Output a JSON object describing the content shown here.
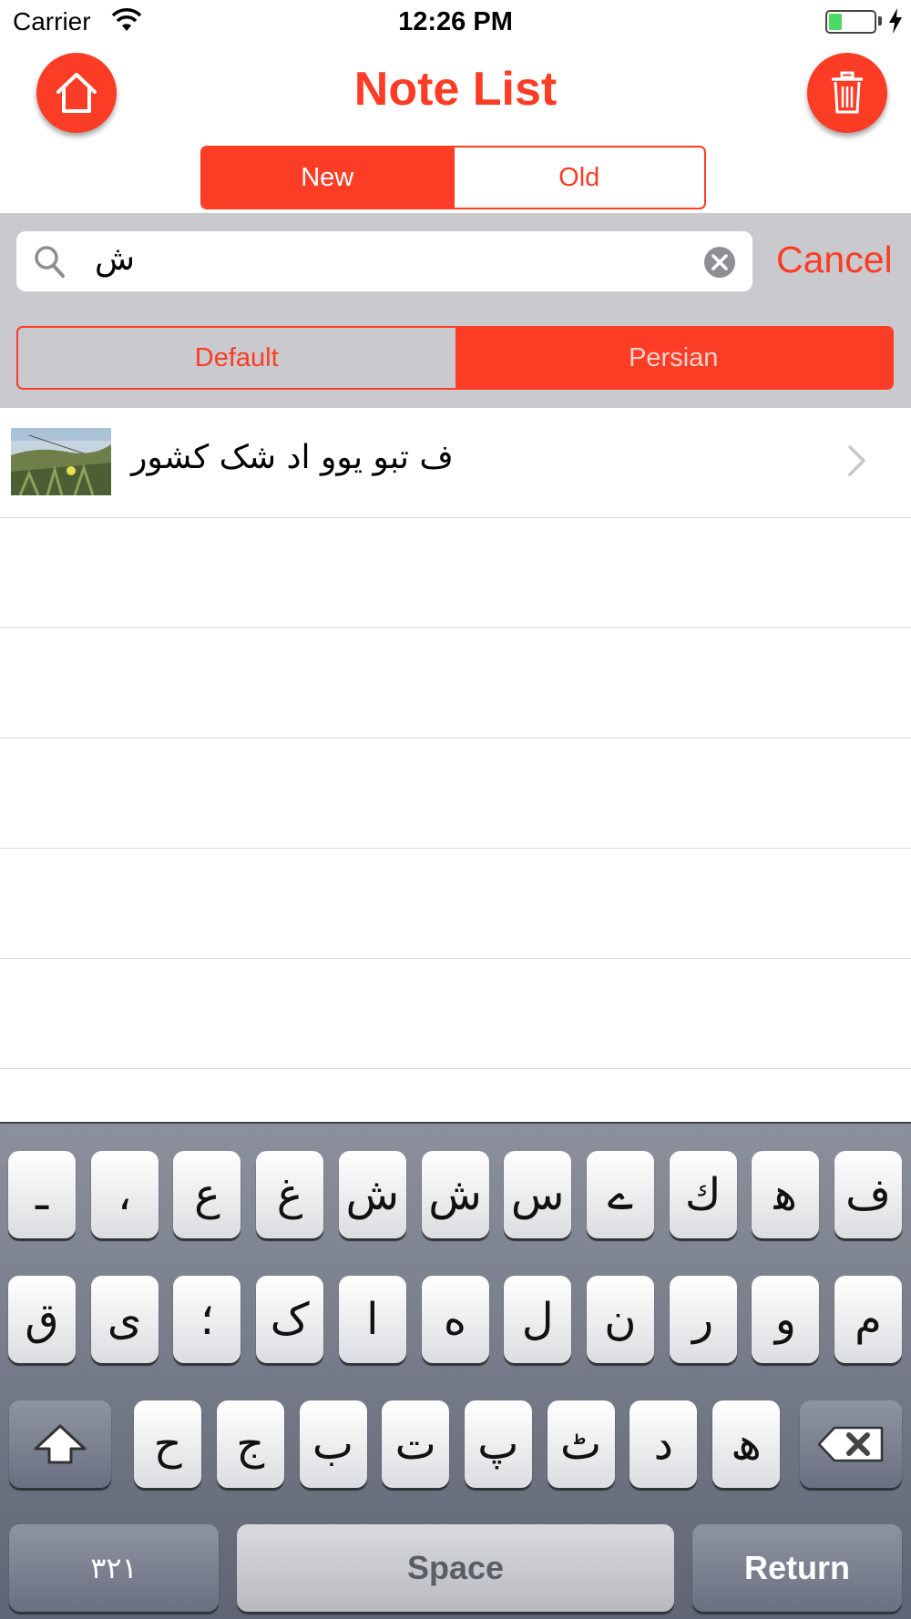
{
  "status_bar": {
    "carrier": "Carrier",
    "time": "12:26 PM",
    "battery_level": 0.3,
    "battery_color": "#4cd964"
  },
  "nav": {
    "title": "Note List",
    "home_icon": "home-icon",
    "trash_icon": "trash-icon",
    "accent_color": "#fc3d26",
    "sort_segments": [
      {
        "label": "New",
        "selected": true
      },
      {
        "label": "Old",
        "selected": false
      }
    ]
  },
  "search": {
    "value": "ش",
    "cancel_label": "Cancel",
    "scope_segments": [
      {
        "label": "Default",
        "selected": false
      },
      {
        "label": "Persian",
        "selected": true
      }
    ]
  },
  "notes": [
    {
      "title": "ف  تبو یوو اد شک کشور",
      "thumbnail": "landscape-photo"
    }
  ],
  "keyboard": {
    "row1": [
      "ف",
      "ﻫ",
      "ك",
      "ے",
      "س",
      "ش",
      "ش",
      "غ",
      "ع",
      "،",
      "ـ"
    ],
    "row2": [
      "م",
      "و",
      "ر",
      "ن",
      "ل",
      "ه",
      "ا",
      "ک",
      "؛",
      "ی",
      "ق"
    ],
    "row3": [
      "ھ",
      "د",
      "ٹ",
      "پ",
      "ت",
      "ب",
      "ج",
      "ح"
    ],
    "numbers_label": "٣٢١",
    "space_label": "Space",
    "return_label": "Return",
    "shift_icon": "shift-icon",
    "delete_icon": "delete-icon"
  }
}
